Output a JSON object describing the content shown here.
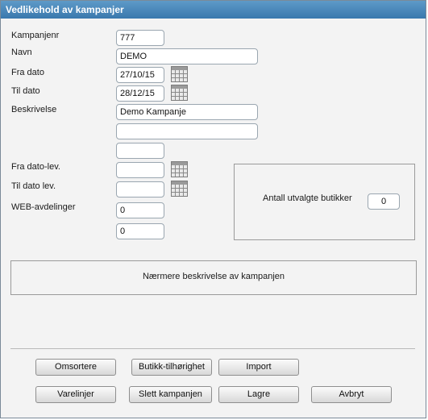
{
  "window": {
    "title": "Vedlikehold av kampanjer"
  },
  "form": {
    "kampanjenr": {
      "label": "Kampanjenr",
      "value": "777"
    },
    "navn": {
      "label": "Navn",
      "value": "DEMO"
    },
    "fra_dato": {
      "label": "Fra dato",
      "value": "27/10/15"
    },
    "til_dato": {
      "label": "Til dato",
      "value": "28/12/15"
    },
    "beskrivelse": {
      "label": "Beskrivelse",
      "value": "Demo Kampanje",
      "value2": "",
      "value3": ""
    },
    "fra_dato_lev": {
      "label": "Fra dato-lev.",
      "value": ""
    },
    "til_dato_lev": {
      "label": "Til dato lev.",
      "value": ""
    },
    "web_avdelinger": {
      "label": "WEB-avdelinger",
      "value1": "0",
      "value2": "0"
    }
  },
  "butikker": {
    "label": "Antall utvalgte butikker",
    "value": "0"
  },
  "details": {
    "text": "Nærmere beskrivelse av kampanjen"
  },
  "buttons": {
    "omsortere": "Omsortere",
    "butikk_tilhorighet": "Butikk-tilhørighet",
    "import": "Import",
    "varelinjer": "Varelinjer",
    "slett_kampanjen": "Slett kampanjen",
    "lagre": "Lagre",
    "avbryt": "Avbryt"
  },
  "icons": {
    "calendar": "calendar-icon"
  }
}
